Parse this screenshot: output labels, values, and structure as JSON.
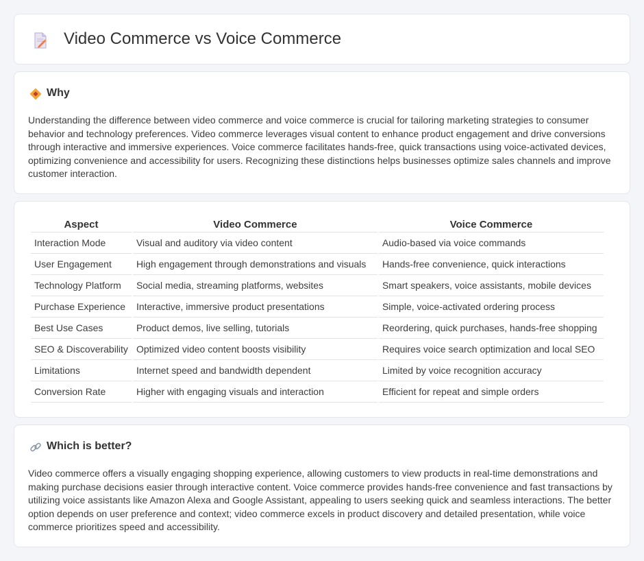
{
  "header": {
    "title": "Video Commerce vs Voice Commerce",
    "icon": "document-pencil-icon"
  },
  "why": {
    "heading": "Why",
    "icon": "diamond-sign-icon",
    "text": "Understanding the difference between video commerce and voice commerce is crucial for tailoring marketing strategies to consumer behavior and technology preferences. Video commerce leverages visual content to enhance product engagement and drive conversions through interactive and immersive experiences. Voice commerce facilitates hands-free, quick transactions using voice-activated devices, optimizing convenience and accessibility for users. Recognizing these distinctions helps businesses optimize sales channels and improve customer interaction."
  },
  "table": {
    "headers": [
      "Aspect",
      "Video Commerce",
      "Voice Commerce"
    ],
    "rows": [
      [
        "Interaction Mode",
        "Visual and auditory via video content",
        "Audio-based via voice commands"
      ],
      [
        "User Engagement",
        "High engagement through demonstrations and visuals",
        "Hands-free convenience, quick interactions"
      ],
      [
        "Technology Platform",
        "Social media, streaming platforms, websites",
        "Smart speakers, voice assistants, mobile devices"
      ],
      [
        "Purchase Experience",
        "Interactive, immersive product presentations",
        "Simple, voice-activated ordering process"
      ],
      [
        "Best Use Cases",
        "Product demos, live selling, tutorials",
        "Reordering, quick purchases, hands-free shopping"
      ],
      [
        "SEO & Discoverability",
        "Optimized video content boosts visibility",
        "Requires voice search optimization and local SEO"
      ],
      [
        "Limitations",
        "Internet speed and bandwidth dependent",
        "Limited by voice recognition accuracy"
      ],
      [
        "Conversion Rate",
        "Higher with engaging visuals and interaction",
        "Efficient for repeat and simple orders"
      ]
    ]
  },
  "better": {
    "heading": "Which is better?",
    "icon": "link-icon",
    "text": "Video commerce offers a visually engaging shopping experience, allowing customers to view products in real-time demonstrations and making purchase decisions easier through interactive content. Voice commerce provides hands-free convenience and fast transactions by utilizing voice assistants like Amazon Alexa and Google Assistant, appealing to users seeking quick and seamless interactions. The better option depends on user preference and context; video commerce excels in product discovery and detailed presentation, while voice commerce prioritizes speed and accessibility."
  },
  "colors": {
    "background": "#f3f5f8",
    "card": "#ffffff",
    "border": "#e3e6ea",
    "accent": "#f0a030"
  }
}
